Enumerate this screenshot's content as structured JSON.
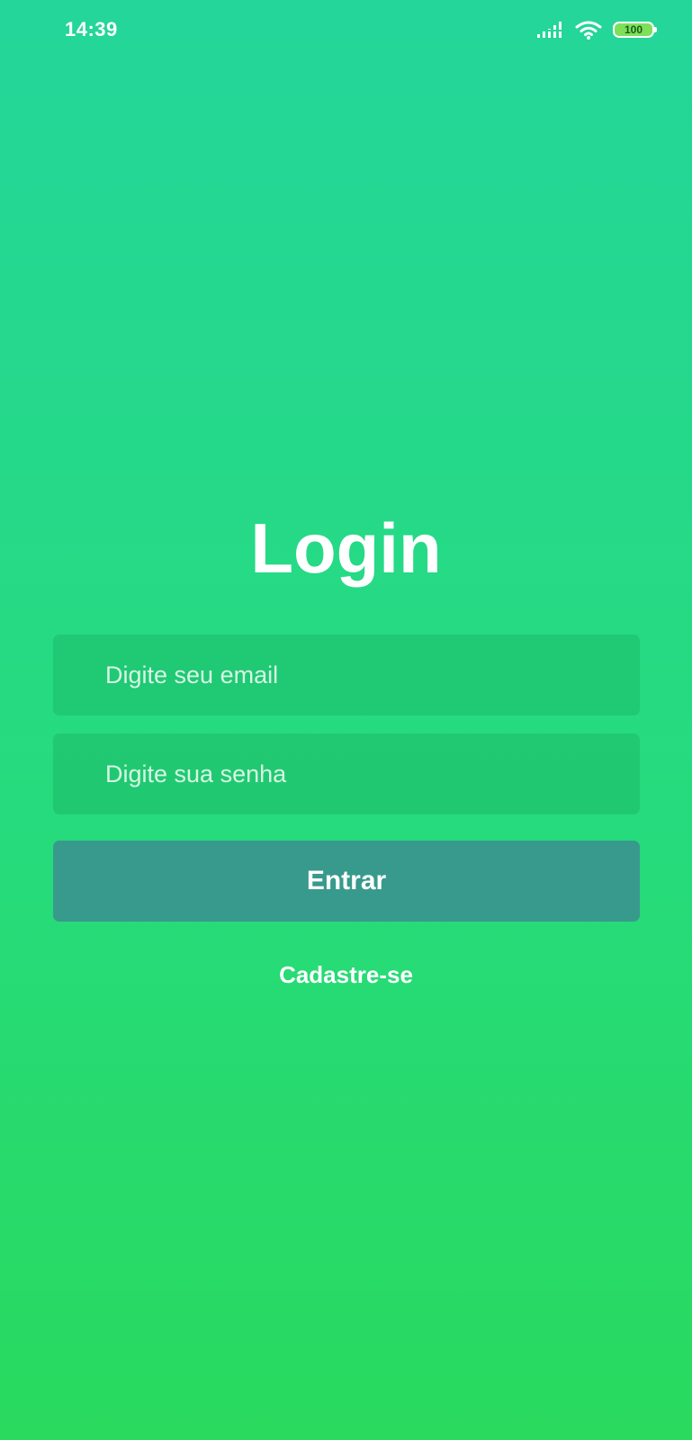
{
  "status_bar": {
    "time": "14:39",
    "battery_level": "100",
    "icons": [
      "signal-icon",
      "wifi-icon",
      "battery-icon"
    ]
  },
  "login": {
    "title": "Login",
    "email_placeholder": "Digite seu email",
    "password_placeholder": "Digite sua senha",
    "submit_label": "Entrar",
    "register_label": "Cadastre-se"
  },
  "colors": {
    "background_top": "#24d69a",
    "background_bottom": "#29da5e",
    "button": "#389a8c",
    "text": "#ffffff"
  }
}
